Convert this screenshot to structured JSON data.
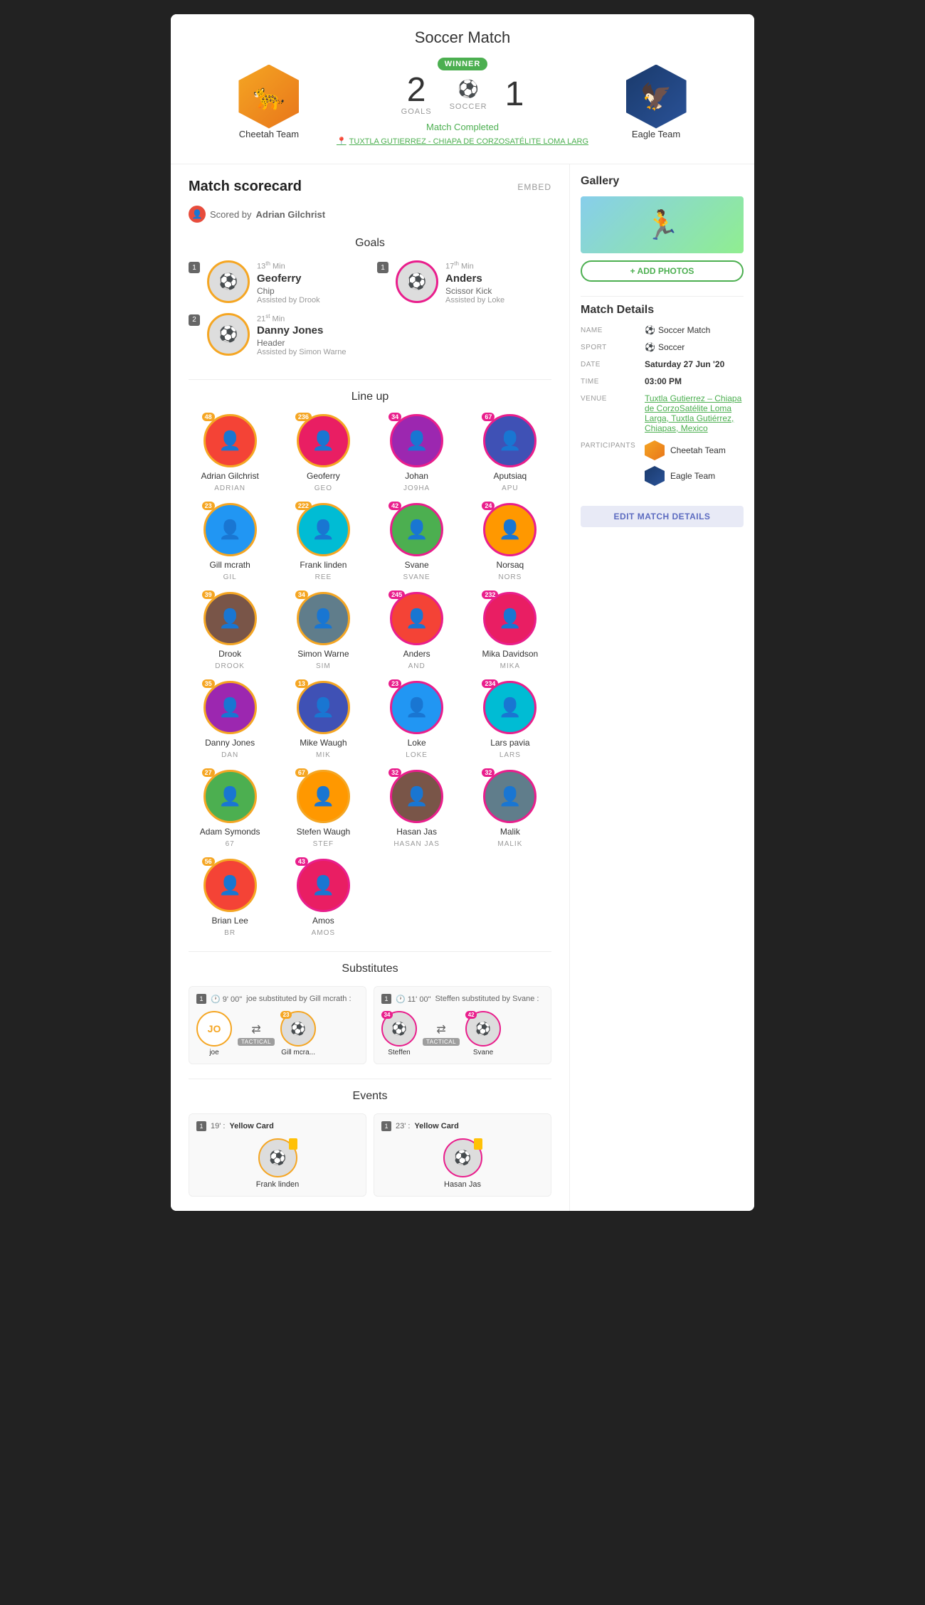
{
  "header": {
    "title": "Soccer Match",
    "cheetah_team": {
      "name": "Cheetah Team",
      "score": "2",
      "goals_label": "GOALS",
      "winner": true,
      "winner_badge": "WINNER",
      "emoji": "🐆"
    },
    "eagle_team": {
      "name": "Eagle Team",
      "score": "1",
      "emoji": "🦅"
    },
    "sport": "SOCCER",
    "status": "Match Completed",
    "venue": "TUXTLA GUTIERREZ - CHIAPA DE CORZOSATÉLITE LOMA LARG"
  },
  "scorecard": {
    "title": "Match scorecard",
    "embed_label": "EMBED",
    "scored_by_label": "Scored by",
    "scorer_name": "Adrian Gilchrist",
    "goals_title": "Goals",
    "goals_left": [
      {
        "number": "1",
        "minute": "13",
        "minute_sup": "th",
        "name": "Geoferry",
        "type": "Chip",
        "assist": "Assisted by Drook",
        "border": "orange"
      },
      {
        "number": "2",
        "minute": "21",
        "minute_sup": "st",
        "name": "Danny Jones",
        "type": "Header",
        "assist": "Assisted by Simon Warne",
        "border": "orange"
      }
    ],
    "goals_right": [
      {
        "number": "1",
        "minute": "17",
        "minute_sup": "th",
        "name": "Anders",
        "type": "Scissor Kick",
        "assist": "Assisted by Loke",
        "border": "pink"
      }
    ],
    "lineup_title": "Line up",
    "players": [
      {
        "name": "Adrian Gilchrist",
        "code": "ADRIAN",
        "number": "48",
        "border": "orange",
        "emoji": "⚽"
      },
      {
        "name": "Geoferry",
        "code": "GEO",
        "number": "236",
        "border": "orange",
        "emoji": "⚽"
      },
      {
        "name": "Johan",
        "code": "JO9HA",
        "number": "34",
        "border": "pink",
        "emoji": "⚽"
      },
      {
        "name": "Aputsiaq",
        "code": "APU",
        "number": "67",
        "border": "pink",
        "emoji": "⚽"
      },
      {
        "name": "Gill mcrath",
        "code": "GIL",
        "number": "23",
        "border": "orange",
        "emoji": "⚽"
      },
      {
        "name": "Frank linden",
        "code": "REE",
        "number": "222",
        "border": "orange",
        "emoji": "⚽"
      },
      {
        "name": "Svane",
        "code": "SVANE",
        "number": "42",
        "border": "pink",
        "emoji": "⚽"
      },
      {
        "name": "Norsaq",
        "code": "NORS",
        "number": "24",
        "border": "pink",
        "emoji": "⚽"
      },
      {
        "name": "Drook",
        "code": "DROOK",
        "number": "39",
        "border": "orange",
        "emoji": "⚽"
      },
      {
        "name": "Simon Warne",
        "code": "SIM",
        "number": "34",
        "border": "orange",
        "emoji": "⚽"
      },
      {
        "name": "Anders",
        "code": "AND",
        "number": "245",
        "border": "pink",
        "emoji": "⚽"
      },
      {
        "name": "Mika Davidson",
        "code": "MIKA",
        "number": "232",
        "border": "pink",
        "emoji": "⚽"
      },
      {
        "name": "Danny Jones",
        "code": "DAN",
        "number": "35",
        "border": "orange",
        "emoji": "⚽"
      },
      {
        "name": "Mike Waugh",
        "code": "MIK",
        "number": "13",
        "border": "orange",
        "emoji": "⚽"
      },
      {
        "name": "Loke",
        "code": "LOKE",
        "number": "23",
        "border": "pink",
        "emoji": "⚽"
      },
      {
        "name": "Lars pavia",
        "code": "LARS",
        "number": "234",
        "border": "pink",
        "emoji": "⚽"
      },
      {
        "name": "Adam Symonds",
        "code": "67",
        "number": "27",
        "border": "orange",
        "emoji": "⚽"
      },
      {
        "name": "Stefen Waugh",
        "code": "STEF",
        "number": "67",
        "border": "orange",
        "emoji": "⚽"
      },
      {
        "name": "Hasan Jas",
        "code": "HASAN JAS",
        "number": "32",
        "border": "pink",
        "emoji": "⚽"
      },
      {
        "name": "Malik",
        "code": "MALIK",
        "number": "32",
        "border": "pink",
        "emoji": "⚽"
      },
      {
        "name": "Brian Lee",
        "code": "BR",
        "number": "56",
        "border": "orange",
        "emoji": "⚽"
      },
      {
        "name": "Amos",
        "code": "AMOS",
        "number": "43",
        "border": "pink",
        "emoji": "⚽"
      }
    ],
    "subs_title": "Substitutes",
    "subs": [
      {
        "number": "1",
        "time": "9' 00\"",
        "description": "joe substituted by Gill mcrath :",
        "player_out": {
          "name": "joe",
          "code": "JO",
          "border": "orange"
        },
        "player_in": {
          "name": "Gill mcra...",
          "number": "23",
          "border": "orange"
        },
        "tactical": true
      },
      {
        "number": "1",
        "time": "11' 00\"",
        "description": "Steffen substituted by Svane :",
        "player_out": {
          "name": "Steffen",
          "number": "34",
          "border": "pink"
        },
        "player_in": {
          "name": "Svane",
          "number": "42",
          "border": "pink"
        },
        "tactical": true
      }
    ],
    "events_title": "Events",
    "events": [
      {
        "number": "1",
        "minute": "19'",
        "type": "Yellow Card",
        "player_name": "Frank linden",
        "border": "orange"
      },
      {
        "number": "1",
        "minute": "23'",
        "type": "Yellow Card",
        "player_name": "Hasan Jas",
        "border": "pink"
      }
    ]
  },
  "gallery": {
    "title": "Gallery",
    "add_photos_label": "+ ADD PHOTOS"
  },
  "match_details": {
    "title": "Match Details",
    "name_label": "NAME",
    "name_value": "Soccer Match",
    "sport_label": "SPORT",
    "sport_value": "Soccer",
    "date_label": "DATE",
    "date_value": "Saturday 27 Jun '20",
    "time_label": "TIME",
    "time_value": "03:00 PM",
    "venue_label": "VENUE",
    "venue_value": "Tuxtla Gutierrez – Chiapa de CorzoSatélite Loma Larga, Tuxtla Gutiérrez, Chiapas, Mexico",
    "participants_label": "PARTICIPANTS",
    "participants": [
      {
        "name": "Cheetah Team",
        "type": "cheetah"
      },
      {
        "name": "Eagle Team",
        "type": "eagle"
      }
    ],
    "edit_button_label": "EDIT MATCH DETAILS"
  }
}
